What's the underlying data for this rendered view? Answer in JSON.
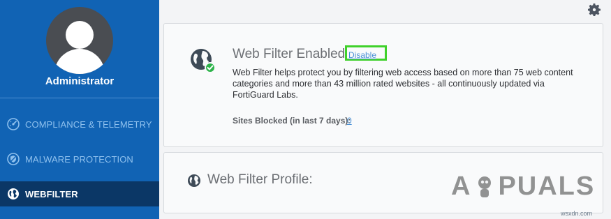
{
  "sidebar": {
    "user_name": "Administrator",
    "items": [
      {
        "label": "COMPLIANCE & TELEMETRY",
        "icon": "gauge-icon",
        "active": false
      },
      {
        "label": "MALWARE PROTECTION",
        "icon": "shield-icon",
        "active": false
      },
      {
        "label": "WEBFILTER",
        "icon": "globe-icon",
        "active": true
      }
    ]
  },
  "web_filter": {
    "title": "Web Filter Enabled",
    "disable_label": "Disable",
    "description": "Web Filter helps protect you by filtering web access based on more than 75 web content categories and more than 43 million rated websites - all continuously updated via FortiGuard Labs.",
    "sites_blocked_label": "Sites Blocked (in last 7 days):",
    "sites_blocked_value": "0"
  },
  "profile": {
    "title": "Web Filter Profile:"
  },
  "watermark": {
    "text_prefix": "A",
    "text_suffix": "PUALS",
    "credit": "wsxdn.com"
  },
  "colors": {
    "sidebar_bg": "#1163b4",
    "sidebar_active_bg": "#0b3766",
    "link": "#4a90d6",
    "highlight_box": "#3fd12a",
    "enabled_badge": "#2db34a"
  },
  "icons": {
    "settings": "gear-icon",
    "status_globe": "globe-check-icon",
    "profile_globe": "globe-icon"
  }
}
